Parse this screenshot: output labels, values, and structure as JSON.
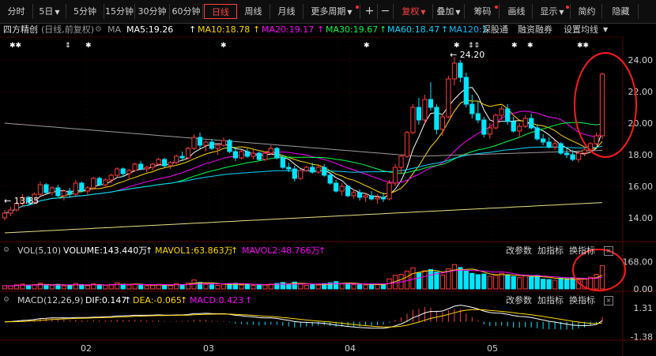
{
  "toolbar": {
    "periods": [
      "分时",
      "5日",
      "5分钟",
      "15分钟",
      "30分钟",
      "60分钟",
      "日线",
      "周线",
      "月线",
      "更多周期"
    ],
    "active_period": "日线",
    "plus": "+",
    "minus": "−",
    "fuquan": "复权",
    "overlay": "叠加",
    "chips": "筹码",
    "draw": "画线",
    "display": "显示",
    "simple": "简约",
    "hide": "隐藏"
  },
  "info": {
    "stock_name": "四方精创",
    "mode": "(日线,前复权)",
    "ma_label": "MA",
    "ma5": "MA5:19.26",
    "ma10": "MA10:18.78",
    "ma20": "MA20:19.17",
    "ma30": "MA30:19.67",
    "ma60": "MA60:18.47",
    "ma120": "MA120:1",
    "shenggutong": "深股通",
    "rongzi": "融资融券",
    "setting": "设置均线",
    "up_arrow": "↑"
  },
  "vol_panel": {
    "title": "VOL(5,10)",
    "volume": "VOLUME:143.440万",
    "mavol1": "MAVOL1:63.863万",
    "mavol2": "MAVOL2:48.766万",
    "change_param": "改参数",
    "add_indicator": "加指标",
    "switch_indicator": "换指标"
  },
  "macd_panel": {
    "title": "MACD(12,26,9)",
    "dif": "DIF:0.147",
    "dea": "DEA:-0.065",
    "macd": "MACD:0.423",
    "change_param": "改参数",
    "add_indicator": "加指标",
    "switch_indicator": "换指标"
  },
  "annotations": {
    "high_label": "24.20",
    "low_label": "13.85"
  },
  "colors": {
    "up": "#ff3b3b",
    "down": "#00e5ff",
    "ma5": "#ffffff",
    "ma10": "#ffd800",
    "ma20": "#ff00ff",
    "ma30": "#00ff44",
    "ma60": "#00d7ff",
    "ma250": "#e8e080",
    "highlight": "#ff1a1a"
  },
  "chart_data": {
    "type": "candlestick",
    "price_axis": {
      "ylim": [
        12.8,
        25.3
      ],
      "ticks": [
        "24.00",
        "22.00",
        "20.00",
        "18.00",
        "16.00",
        "14.00"
      ]
    },
    "x_labels": [
      "02",
      "03",
      "04",
      "05"
    ],
    "candles": [
      [
        14.0,
        14.5,
        13.85,
        14.3
      ],
      [
        14.3,
        14.7,
        14.1,
        14.5
      ],
      [
        14.5,
        15.0,
        14.4,
        14.9
      ],
      [
        14.9,
        15.5,
        14.7,
        15.3
      ],
      [
        15.3,
        15.4,
        14.8,
        15.0
      ],
      [
        15.0,
        15.6,
        14.9,
        15.5
      ],
      [
        15.5,
        16.3,
        15.4,
        16.1
      ],
      [
        16.1,
        16.2,
        15.5,
        15.6
      ],
      [
        15.6,
        16.0,
        15.4,
        15.9
      ],
      [
        15.9,
        16.1,
        15.3,
        15.4
      ],
      [
        15.4,
        15.8,
        15.1,
        15.7
      ],
      [
        15.7,
        15.9,
        15.3,
        15.5
      ],
      [
        15.5,
        16.4,
        15.4,
        16.2
      ],
      [
        16.2,
        16.3,
        15.6,
        15.7
      ],
      [
        15.7,
        16.0,
        15.4,
        15.9
      ],
      [
        15.9,
        16.6,
        15.8,
        16.5
      ],
      [
        16.5,
        16.6,
        16.0,
        16.1
      ],
      [
        16.1,
        16.5,
        15.9,
        16.4
      ],
      [
        16.4,
        16.8,
        16.2,
        16.7
      ],
      [
        16.7,
        17.2,
        16.6,
        17.1
      ],
      [
        17.1,
        17.2,
        16.6,
        16.8
      ],
      [
        16.8,
        17.1,
        16.5,
        17.0
      ],
      [
        17.0,
        17.5,
        16.9,
        17.4
      ],
      [
        17.4,
        17.6,
        17.0,
        17.1
      ],
      [
        17.1,
        17.3,
        16.9,
        17.2
      ],
      [
        17.2,
        17.5,
        17.0,
        17.4
      ],
      [
        17.4,
        17.8,
        17.3,
        17.7
      ],
      [
        17.7,
        17.8,
        17.2,
        17.3
      ],
      [
        17.3,
        17.6,
        17.1,
        17.5
      ],
      [
        17.5,
        18.0,
        17.4,
        17.9
      ],
      [
        17.9,
        18.2,
        17.6,
        17.8
      ],
      [
        17.8,
        18.5,
        17.7,
        18.4
      ],
      [
        18.4,
        19.3,
        18.3,
        19.1
      ],
      [
        19.1,
        19.4,
        18.4,
        18.6
      ],
      [
        18.6,
        18.9,
        18.2,
        18.8
      ],
      [
        18.8,
        19.0,
        18.3,
        18.4
      ],
      [
        18.4,
        18.7,
        18.0,
        18.6
      ],
      [
        18.6,
        19.1,
        18.5,
        18.9
      ],
      [
        18.9,
        19.0,
        18.1,
        18.2
      ],
      [
        18.2,
        18.5,
        17.6,
        17.8
      ],
      [
        17.8,
        18.3,
        17.7,
        18.2
      ],
      [
        18.2,
        18.4,
        17.8,
        17.9
      ],
      [
        17.9,
        18.3,
        17.7,
        18.1
      ],
      [
        18.1,
        18.2,
        17.6,
        17.7
      ],
      [
        17.7,
        18.2,
        17.6,
        18.1
      ],
      [
        18.1,
        18.6,
        18.0,
        18.4
      ],
      [
        18.4,
        18.5,
        17.7,
        17.8
      ],
      [
        17.8,
        18.0,
        17.1,
        17.2
      ],
      [
        17.2,
        17.5,
        16.9,
        17.1
      ],
      [
        17.1,
        17.3,
        16.3,
        16.5
      ],
      [
        16.5,
        17.1,
        16.4,
        17.0
      ],
      [
        17.0,
        17.3,
        16.9,
        17.2
      ],
      [
        17.2,
        17.5,
        16.8,
        16.9
      ],
      [
        16.9,
        17.4,
        16.8,
        17.2
      ],
      [
        17.2,
        17.4,
        16.6,
        16.7
      ],
      [
        16.7,
        16.9,
        16.1,
        16.2
      ],
      [
        16.2,
        16.4,
        15.6,
        15.7
      ],
      [
        15.7,
        16.2,
        15.4,
        16.0
      ],
      [
        16.0,
        16.1,
        15.3,
        15.4
      ],
      [
        15.4,
        15.8,
        15.2,
        15.6
      ],
      [
        15.6,
        15.8,
        15.1,
        15.3
      ],
      [
        15.3,
        15.6,
        15.0,
        15.4
      ],
      [
        15.4,
        15.7,
        15.1,
        15.2
      ],
      [
        15.2,
        15.5,
        14.9,
        15.3
      ],
      [
        15.3,
        15.6,
        15.0,
        15.2
      ],
      [
        15.2,
        16.4,
        15.1,
        16.2
      ],
      [
        16.2,
        17.4,
        16.0,
        17.2
      ],
      [
        17.2,
        18.0,
        16.8,
        17.9
      ],
      [
        17.9,
        19.5,
        17.8,
        19.4
      ],
      [
        19.4,
        21.2,
        19.3,
        21.0
      ],
      [
        21.0,
        21.6,
        19.9,
        20.2
      ],
      [
        20.2,
        21.8,
        20.0,
        21.5
      ],
      [
        21.5,
        22.6,
        20.8,
        21.0
      ],
      [
        21.0,
        21.2,
        19.3,
        19.6
      ],
      [
        19.6,
        20.6,
        19.2,
        20.4
      ],
      [
        20.4,
        23.0,
        20.3,
        22.8
      ],
      [
        22.8,
        24.2,
        22.4,
        23.8
      ],
      [
        23.8,
        24.0,
        22.6,
        22.9
      ],
      [
        22.9,
        23.2,
        21.0,
        21.2
      ],
      [
        21.2,
        21.8,
        20.3,
        20.6
      ],
      [
        20.6,
        21.4,
        20.0,
        20.2
      ],
      [
        20.2,
        20.4,
        19.1,
        19.3
      ],
      [
        19.3,
        20.0,
        19.0,
        19.7
      ],
      [
        19.7,
        20.6,
        19.6,
        20.5
      ],
      [
        20.5,
        21.1,
        20.2,
        20.9
      ],
      [
        20.9,
        21.2,
        19.9,
        20.1
      ],
      [
        20.1,
        20.4,
        19.4,
        19.5
      ],
      [
        19.5,
        20.0,
        19.1,
        19.8
      ],
      [
        19.8,
        20.5,
        19.7,
        20.3
      ],
      [
        20.3,
        20.6,
        19.6,
        19.7
      ],
      [
        19.7,
        19.9,
        18.9,
        19.0
      ],
      [
        19.0,
        19.3,
        18.6,
        18.8
      ],
      [
        18.8,
        19.1,
        18.4,
        18.5
      ],
      [
        18.5,
        18.9,
        18.3,
        18.7
      ],
      [
        18.7,
        18.8,
        18.0,
        18.1
      ],
      [
        18.1,
        18.4,
        17.8,
        18.0
      ],
      [
        18.0,
        18.3,
        17.6,
        17.7
      ],
      [
        17.7,
        18.2,
        17.5,
        18.1
      ],
      [
        18.1,
        18.5,
        17.9,
        18.3
      ],
      [
        18.3,
        18.8,
        18.1,
        18.7
      ],
      [
        18.7,
        19.4,
        18.6,
        19.2
      ],
      [
        19.2,
        23.2,
        19.0,
        23.1
      ]
    ],
    "volume_axis": {
      "ylim": [
        0,
        190
      ],
      "ticks": [
        "168.00",
        "0.00"
      ]
    },
    "volume": [
      20,
      18,
      25,
      30,
      22,
      26,
      35,
      24,
      21,
      28,
      19,
      22,
      33,
      26,
      20,
      31,
      24,
      22,
      27,
      38,
      29,
      24,
      30,
      25,
      20,
      22,
      28,
      24,
      21,
      33,
      27,
      36,
      55,
      40,
      28,
      26,
      22,
      30,
      33,
      35,
      24,
      26,
      22,
      28,
      25,
      30,
      34,
      40,
      28,
      42,
      30,
      22,
      26,
      24,
      33,
      38,
      45,
      30,
      36,
      26,
      29,
      24,
      28,
      26,
      27,
      62,
      84,
      90,
      110,
      130,
      98,
      112,
      120,
      104,
      86,
      124,
      150,
      132,
      110,
      96,
      88,
      92,
      78,
      84,
      96,
      88,
      76,
      70,
      82,
      76,
      84,
      60,
      58,
      54,
      66,
      64,
      70,
      54,
      60,
      72,
      90,
      143
    ],
    "volume_down": [
      false,
      false,
      false,
      false,
      true,
      false,
      false,
      true,
      false,
      true,
      false,
      true,
      false,
      true,
      false,
      false,
      true,
      false,
      false,
      false,
      true,
      false,
      false,
      true,
      false,
      false,
      false,
      true,
      false,
      false,
      true,
      false,
      false,
      true,
      false,
      true,
      false,
      false,
      true,
      true,
      false,
      true,
      false,
      true,
      false,
      false,
      true,
      true,
      true,
      true,
      false,
      false,
      true,
      false,
      true,
      true,
      true,
      false,
      true,
      false,
      true,
      false,
      true,
      false,
      true,
      false,
      false,
      false,
      false,
      false,
      true,
      false,
      true,
      true,
      false,
      false,
      false,
      true,
      true,
      true,
      true,
      true,
      false,
      false,
      false,
      true,
      true,
      false,
      false,
      true,
      true,
      true,
      true,
      false,
      true,
      true,
      true,
      false,
      false,
      false,
      false,
      false
    ],
    "macd_axis": {
      "ylim": [
        -1.5,
        1.45
      ],
      "ticks": [
        "1.31",
        "-1.38"
      ]
    }
  }
}
